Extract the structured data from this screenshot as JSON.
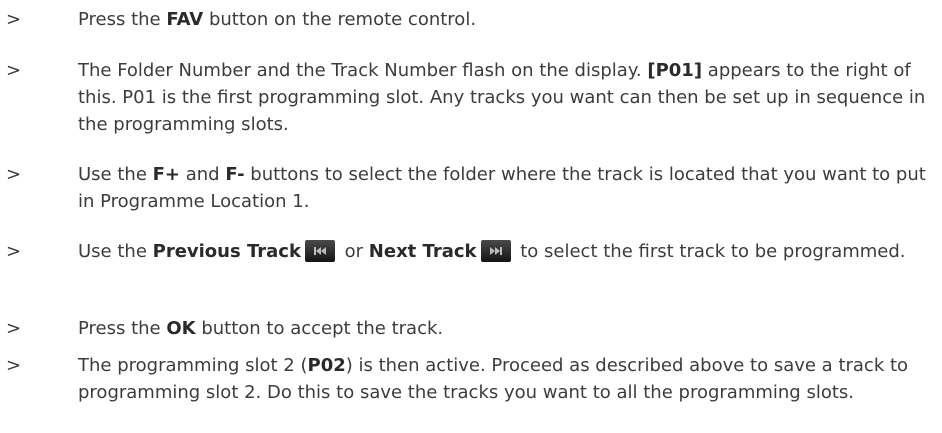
{
  "steps": [
    {
      "marker": ">",
      "parts": [
        "Press the ",
        "FAV",
        " button on the remote control."
      ]
    },
    {
      "marker": ">",
      "parts": [
        "The Folder Number and the Track Number flash on the display. ",
        "[P01]",
        " appears to the right of this. P01 is the first programming slot. Any tracks you want can then be set up in sequence in the programming slots."
      ]
    },
    {
      "marker": ">",
      "parts": [
        "Use the ",
        "F+",
        " and ",
        "F-",
        " buttons to select the folder where the track is located that you want to put in Programme Location 1."
      ]
    },
    {
      "marker": ">",
      "parts": [
        "Use the ",
        "Previous Track",
        " or ",
        "Next Track",
        " to select the first track to be programmed."
      ],
      "icons": [
        "previous-track-icon",
        "next-track-icon"
      ]
    },
    {
      "marker": ">",
      "parts": [
        "Press the ",
        "OK",
        " button to accept the track."
      ]
    },
    {
      "marker": ">",
      "parts": [
        "The programming slot 2 (",
        "P02",
        ") is then active. Proceed as described above to save a track to programming slot 2. Do this to save the tracks you want to all the programming slots."
      ]
    }
  ]
}
